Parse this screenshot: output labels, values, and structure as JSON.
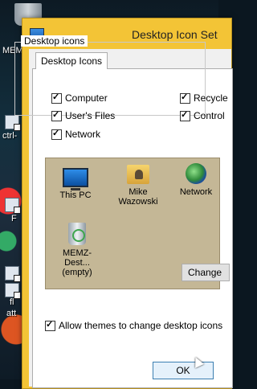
{
  "window": {
    "title": "Desktop Icon Set"
  },
  "tabs": [
    {
      "label": "Desktop Icons"
    }
  ],
  "desktop_icons_group": {
    "label": "Desktop icons",
    "checkboxes": [
      {
        "label": "Computer",
        "checked": true
      },
      {
        "label": "Recycle",
        "checked": true
      },
      {
        "label": "User's Files",
        "checked": true
      },
      {
        "label": "Control",
        "checked": true
      },
      {
        "label": "Network",
        "checked": true
      }
    ]
  },
  "icon_list": [
    {
      "line1": "This PC",
      "line2": "",
      "icon": "this-pc-icon"
    },
    {
      "line1": "Mike",
      "line2": "Wazowski",
      "icon": "user-folder-icon"
    },
    {
      "line1": "Network",
      "line2": "",
      "icon": "network-icon"
    },
    {
      "line1": "MEMZ-Dest...",
      "line2": "(empty)",
      "icon": "recycle-bin-icon"
    }
  ],
  "buttons": {
    "change": "Change",
    "ok": "OK"
  },
  "allow_themes": {
    "label": "Allow themes to change desktop icons",
    "checked": true
  },
  "desktop_background": {
    "labels": [
      "MEM",
      "ctrl-",
      "F",
      "fl",
      "att"
    ]
  }
}
